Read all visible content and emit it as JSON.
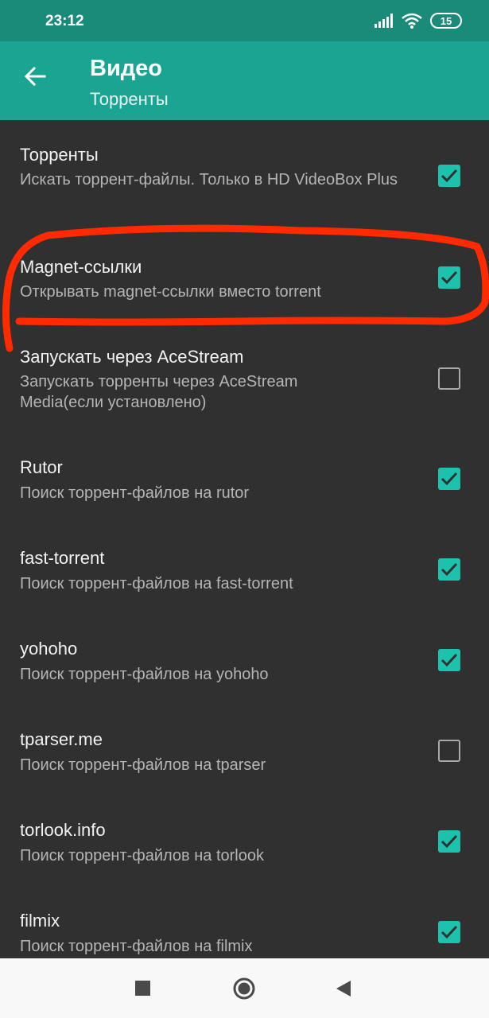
{
  "status_bar": {
    "time": "23:12",
    "battery": "15",
    "icons": [
      "signal-icon",
      "wifi-icon",
      "battery-icon"
    ]
  },
  "app_bar": {
    "title": "Видео",
    "subtitle": "Торренты",
    "back_icon": "arrow-back-icon"
  },
  "colors": {
    "app_bar": "#1aa593",
    "status_bar": "#1a8a79",
    "background": "#303030",
    "accent": "#1dc2ad",
    "annotation": "#ff2a00"
  },
  "settings": [
    {
      "title": "Торренты",
      "summary": "Искать торрент-файлы. Только в HD VideoBox Plus",
      "checked": true
    },
    {
      "title": "Magnet-ссылки",
      "summary": "Открывать magnet-ссылки вместо torrent",
      "checked": true
    },
    {
      "title": "Запускать через AceStream",
      "summary": "Запускать торренты через AceStream Media(если установлено)",
      "checked": false
    },
    {
      "title": "Rutor",
      "summary": "Поиск торрент-файлов на rutor",
      "checked": true
    },
    {
      "title": "fast-torrent",
      "summary": "Поиск торрент-файлов на fast-torrent",
      "checked": true
    },
    {
      "title": "yohoho",
      "summary": "Поиск торрент-файлов на yohoho",
      "checked": true
    },
    {
      "title": "tparser.me",
      "summary": "Поиск торрент-файлов на tparser",
      "checked": false
    },
    {
      "title": "torlook.info",
      "summary": "Поиск торрент-файлов на torlook",
      "checked": true
    },
    {
      "title": "filmix",
      "summary": "Поиск торрент-файлов на filmix",
      "checked": true
    }
  ],
  "annotation": {
    "type": "hand-drawn red outline",
    "highlights": "Magnet-ссылки"
  },
  "nav_bar": {
    "buttons": [
      "recents-square-icon",
      "home-circle-icon",
      "back-triangle-icon"
    ]
  }
}
